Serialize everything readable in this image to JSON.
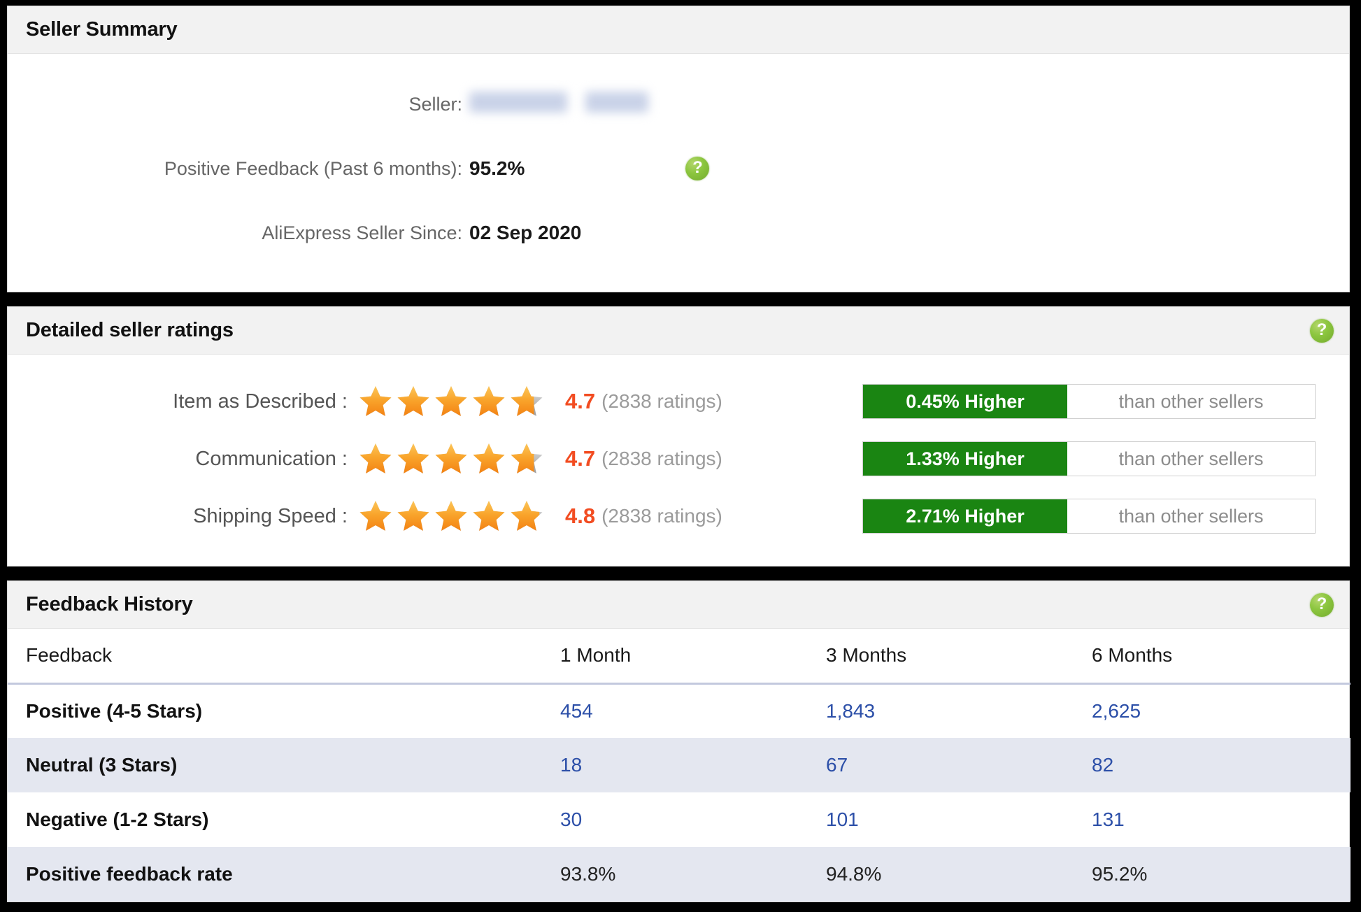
{
  "seller_summary": {
    "title": "Seller Summary",
    "rows": [
      {
        "label": "Seller:",
        "value": "",
        "redacted": true
      },
      {
        "label": "Positive Feedback (Past 6 months):",
        "value": "95.2%"
      },
      {
        "label": "AliExpress Seller Since:",
        "value": "02 Sep 2020"
      }
    ],
    "help_icon": "help-question-icon"
  },
  "detailed_seller_ratings": {
    "title": "Detailed seller ratings",
    "help_icon": "help-question-icon",
    "rows": [
      {
        "label": "Item as Described :",
        "score": "4.7",
        "count": "(2838 ratings)",
        "stars_filled": 4.7,
        "compare_value": "0.45% Higher",
        "compare_text": "than other sellers"
      },
      {
        "label": "Communication :",
        "score": "4.7",
        "count": "(2838 ratings)",
        "stars_filled": 4.7,
        "compare_value": "1.33% Higher",
        "compare_text": "than other sellers"
      },
      {
        "label": "Shipping Speed :",
        "score": "4.8",
        "count": "(2838 ratings)",
        "stars_filled": 4.85,
        "compare_value": "2.71% Higher",
        "compare_text": "than other sellers"
      }
    ]
  },
  "feedback_history": {
    "title": "Feedback History",
    "help_icon": "help-question-icon",
    "columns": [
      "Feedback",
      "1 Month",
      "3 Months",
      "6 Months"
    ],
    "rows": [
      {
        "label": "Positive (4-5 Stars)",
        "m1": "454",
        "m3": "1,843",
        "m6": "2,625",
        "kind": "count"
      },
      {
        "label": "Neutral (3 Stars)",
        "m1": "18",
        "m3": "67",
        "m6": "82",
        "kind": "count"
      },
      {
        "label": "Negative (1-2 Stars)",
        "m1": "30",
        "m3": "101",
        "m6": "131",
        "kind": "count"
      },
      {
        "label": "Positive feedback rate",
        "m1": "93.8%",
        "m3": "94.8%",
        "m6": "95.2%",
        "kind": "rate"
      }
    ]
  },
  "colors": {
    "header_bg": "#f2f2f2",
    "green_bar": "#1a8512",
    "help_green": "#8cc63f",
    "score_orange": "#f24c21",
    "star_orange": "#f79321",
    "star_empty": "#b7b7b7",
    "link_blue": "#2c4fa8",
    "alt_row": "#e4e7f0"
  }
}
